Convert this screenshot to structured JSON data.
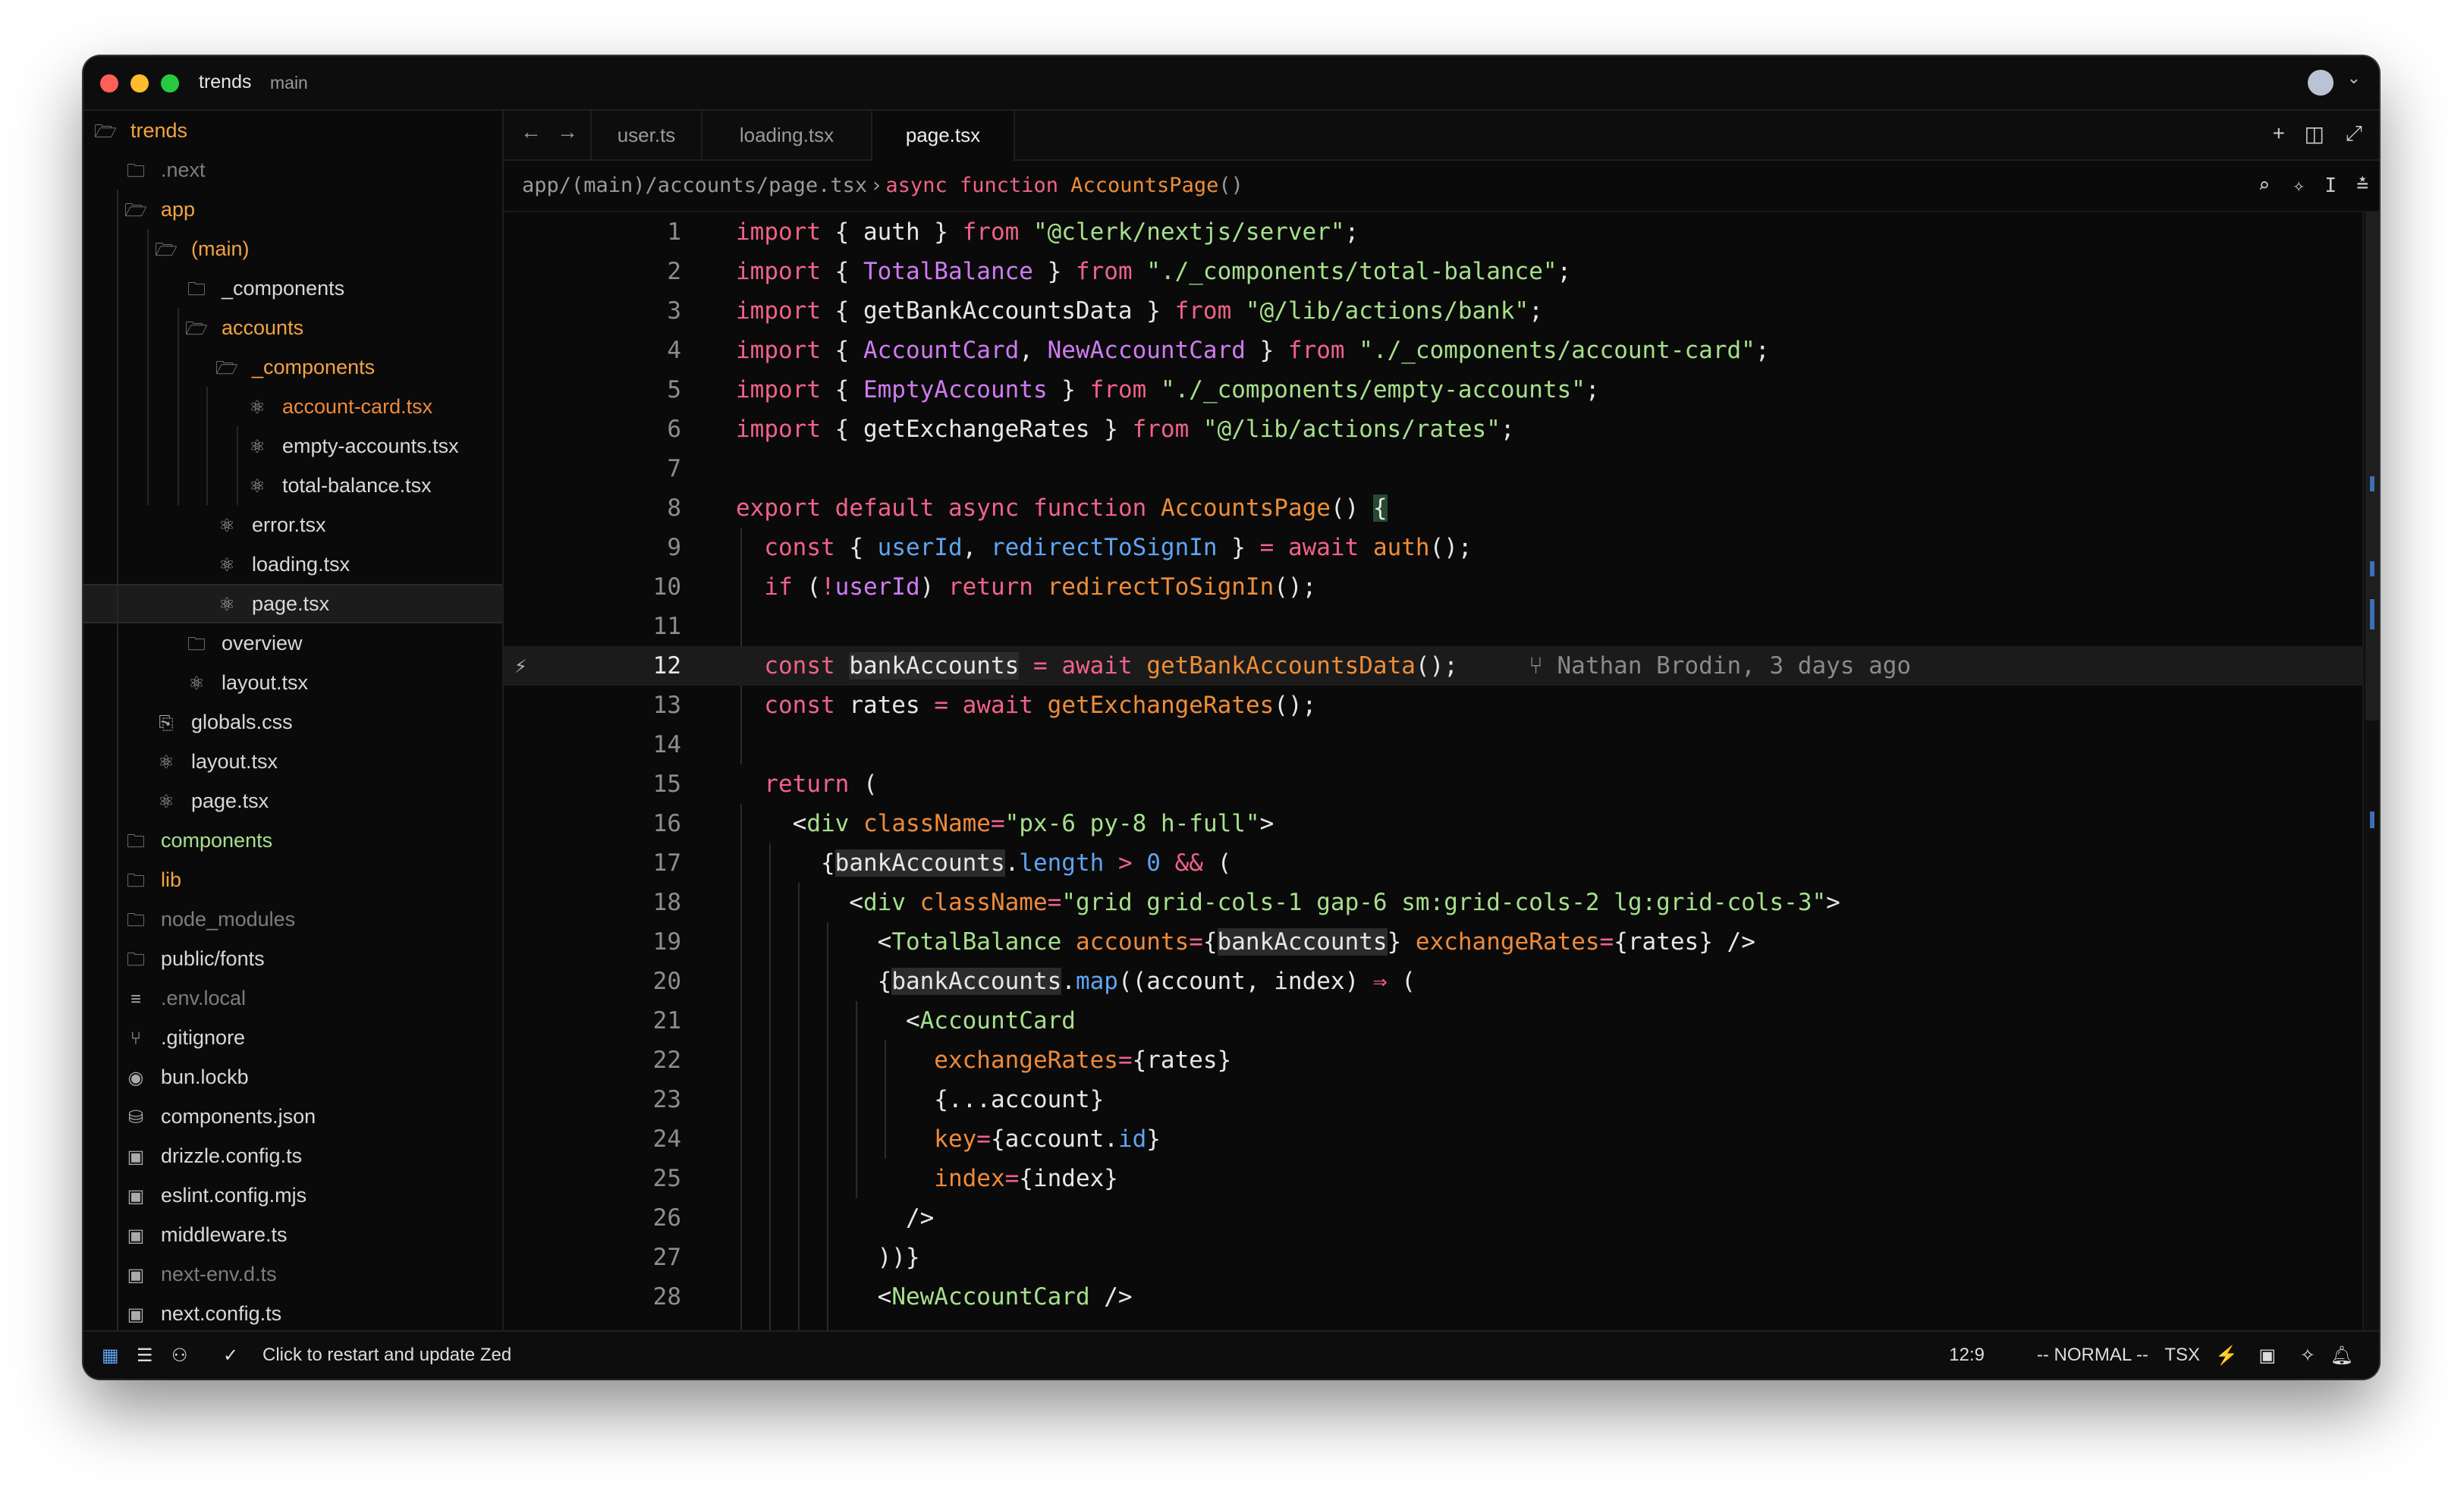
{
  "titlebar": {
    "project": "trends",
    "branch": "main"
  },
  "sidebar": {
    "items": [
      {
        "label": "trends",
        "icon": "folder-open-icon",
        "tone": "open"
      },
      {
        "label": ".next",
        "icon": "folder-icon",
        "tone": "dim"
      },
      {
        "label": "app",
        "icon": "folder-open-icon",
        "tone": "open"
      },
      {
        "label": "(main)",
        "icon": "folder-open-icon",
        "tone": "open"
      },
      {
        "label": "_components",
        "icon": "folder-icon",
        "tone": "normal"
      },
      {
        "label": "accounts",
        "icon": "folder-open-icon",
        "tone": "open"
      },
      {
        "label": "_components",
        "icon": "folder-open-icon",
        "tone": "open"
      },
      {
        "label": "account-card.tsx",
        "icon": "react-icon",
        "tone": "orange"
      },
      {
        "label": "empty-accounts.tsx",
        "icon": "react-icon",
        "tone": "normal"
      },
      {
        "label": "total-balance.tsx",
        "icon": "react-icon",
        "tone": "normal"
      },
      {
        "label": "error.tsx",
        "icon": "react-icon",
        "tone": "normal"
      },
      {
        "label": "loading.tsx",
        "icon": "react-icon",
        "tone": "normal"
      },
      {
        "label": "page.tsx",
        "icon": "react-icon",
        "tone": "normal"
      },
      {
        "label": "overview",
        "icon": "folder-icon",
        "tone": "normal"
      },
      {
        "label": "layout.tsx",
        "icon": "react-icon",
        "tone": "normal"
      },
      {
        "label": "globals.css",
        "icon": "css-icon",
        "tone": "normal"
      },
      {
        "label": "layout.tsx",
        "icon": "react-icon",
        "tone": "normal"
      },
      {
        "label": "page.tsx",
        "icon": "react-icon",
        "tone": "normal"
      },
      {
        "label": "components",
        "icon": "folder-icon",
        "tone": "green"
      },
      {
        "label": "lib",
        "icon": "folder-icon",
        "tone": "open"
      },
      {
        "label": "node_modules",
        "icon": "folder-icon",
        "tone": "dim"
      },
      {
        "label": "public/fonts",
        "icon": "folder-icon",
        "tone": "normal"
      },
      {
        "label": ".env.local",
        "icon": "lines-icon",
        "tone": "dim"
      },
      {
        "label": ".gitignore",
        "icon": "git-icon",
        "tone": "normal"
      },
      {
        "label": "bun.lockb",
        "icon": "bun-icon",
        "tone": "normal"
      },
      {
        "label": "components.json",
        "icon": "database-icon",
        "tone": "normal"
      },
      {
        "label": "drizzle.config.ts",
        "icon": "ts-icon",
        "tone": "normal"
      },
      {
        "label": "eslint.config.mjs",
        "icon": "js-icon",
        "tone": "normal"
      },
      {
        "label": "middleware.ts",
        "icon": "ts-icon",
        "tone": "normal"
      },
      {
        "label": "next-env.d.ts",
        "icon": "ts-icon",
        "tone": "dim"
      },
      {
        "label": "next.config.ts",
        "icon": "ts-icon",
        "tone": "normal"
      }
    ]
  },
  "tabs": [
    {
      "label": "user.ts",
      "active": false
    },
    {
      "label": "loading.tsx",
      "active": false
    },
    {
      "label": "page.tsx",
      "active": true
    }
  ],
  "breadcrumb": {
    "path": "app/(main)/accounts/page.tsx",
    "separator": "›",
    "symbol_keywords": "async function",
    "symbol_name": "AccountsPage",
    "symbol_parens": "()"
  },
  "editor": {
    "current_line": 12,
    "blame": "Nathan Brodin, 3 days ago",
    "lines": [
      "import { auth } from \"@clerk/nextjs/server\";",
      "import { TotalBalance } from \"./_components/total-balance\";",
      "import { getBankAccountsData } from \"@/lib/actions/bank\";",
      "import { AccountCard, NewAccountCard } from \"./_components/account-card\";",
      "import { EmptyAccounts } from \"./_components/empty-accounts\";",
      "import { getExchangeRates } from \"@/lib/actions/rates\";",
      "",
      "export default async function AccountsPage() {",
      "  const { userId, redirectToSignIn } = await auth();",
      "  if (!userId) return redirectToSignIn();",
      "",
      "  const bankAccounts = await getBankAccountsData();",
      "  const rates = await getExchangeRates();",
      "",
      "  return (",
      "    <div className=\"px-6 py-8 h-full\">",
      "      {bankAccounts.length > 0 && (",
      "        <div className=\"grid grid-cols-1 gap-6 sm:grid-cols-2 lg:grid-cols-3\">",
      "          <TotalBalance accounts={bankAccounts} exchangeRates={rates} />",
      "          {bankAccounts.map((account, index) => (",
      "            <AccountCard",
      "              exchangeRates={rates}",
      "              {...account}",
      "              key={account.id}",
      "              index={index}",
      "            />",
      "          ))}",
      "          <NewAccountCard />"
    ]
  },
  "statusbar": {
    "update_text": "Click to restart and update Zed",
    "cursor": "12:9",
    "mode": "-- NORMAL --",
    "language": "TSX"
  },
  "colors": {
    "keyword": "#f0628a",
    "string": "#a6e08b",
    "function": "#ed8d38",
    "identifier": "#cf7bf2",
    "property": "#5fa4f2",
    "folder_open": "#f2a341"
  }
}
